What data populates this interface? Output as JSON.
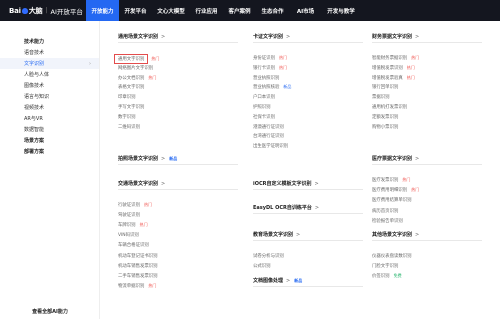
{
  "logo": {
    "mark_a": "Bai",
    "mark_b": "大脑",
    "separator": "|",
    "brand": "AI开放平台"
  },
  "nav": [
    "开放能力",
    "开发平台",
    "文心大模型",
    "行业应用",
    "客户案例",
    "生态合作",
    "AI市场",
    "开发与教学"
  ],
  "sidebar": {
    "items": [
      {
        "label": "技术能力",
        "kind": "group"
      },
      {
        "label": "语音技术",
        "kind": "item"
      },
      {
        "label": "文字识别",
        "kind": "active",
        "arrow": "›"
      },
      {
        "label": "人脸与人体",
        "kind": "item"
      },
      {
        "label": "图像技术",
        "kind": "item"
      },
      {
        "label": "语言与知识",
        "kind": "item"
      },
      {
        "label": "视频技术",
        "kind": "item"
      },
      {
        "label": "AR与VR",
        "kind": "item"
      },
      {
        "label": "数据智能",
        "kind": "item"
      },
      {
        "label": "场景方案",
        "kind": "group"
      },
      {
        "label": "部署方案",
        "kind": "group"
      }
    ],
    "footer": "查看全部AI能力"
  },
  "tags": {
    "hot": "热门",
    "new": "新品",
    "free": "免费"
  },
  "col1": {
    "s1": {
      "title": "通用场景文字识别",
      "chev": ">"
    },
    "s1_items": [
      {
        "label": "通用文字识别",
        "tag": "hot",
        "highlight": true
      },
      {
        "label": "网络图片文字识别",
        "tag": ""
      },
      {
        "label": "办公文档识别",
        "tag": "hot"
      },
      {
        "label": "表格文字识别",
        "tag": ""
      },
      {
        "label": "印章识别",
        "tag": ""
      },
      {
        "label": "手写文字识别",
        "tag": ""
      },
      {
        "label": "数字识别",
        "tag": ""
      },
      {
        "label": "二维码识别",
        "tag": ""
      }
    ],
    "s2": {
      "title": "拍照场景文字识别",
      "chev": ">",
      "tag": "new"
    },
    "s3": {
      "title": "交通场景文字识别",
      "chev": ">"
    },
    "s3_items": [
      {
        "label": "行驶证识别",
        "tag": "hot"
      },
      {
        "label": "驾驶证识别",
        "tag": ""
      },
      {
        "label": "车牌识别",
        "tag": "hot"
      },
      {
        "label": "VIN码识别",
        "tag": ""
      },
      {
        "label": "车辆合格证识别",
        "tag": ""
      },
      {
        "label": "机动车登记证书识别",
        "tag": ""
      },
      {
        "label": "机动车销售发票识别",
        "tag": ""
      },
      {
        "label": "二手车销售发票识别",
        "tag": ""
      },
      {
        "label": "物流单据识别",
        "tag": "hot"
      }
    ]
  },
  "col2": {
    "s1": {
      "title": "卡证文字识别",
      "chev": ">"
    },
    "s1_items": [
      {
        "label": "身份证识别",
        "tag": "hot"
      },
      {
        "label": "银行卡识别",
        "tag": "hot"
      },
      {
        "label": "营业执照识别",
        "tag": ""
      },
      {
        "label": "营业执照核验",
        "tag": "new"
      },
      {
        "label": "户口本识别",
        "tag": ""
      },
      {
        "label": "护照识别",
        "tag": ""
      },
      {
        "label": "社保卡识别",
        "tag": ""
      },
      {
        "label": "港澳通行证识别",
        "tag": ""
      },
      {
        "label": "台湾通行证识别",
        "tag": ""
      },
      {
        "label": "出生医学证明识别",
        "tag": ""
      }
    ],
    "s2": {
      "title": "iOCR自定义模板文字识别",
      "chev": ">"
    },
    "s3": {
      "title": "EasyDL OCR自训练平台",
      "chev": ">"
    },
    "s4": {
      "title": "教育场景文字识别",
      "chev": ">"
    },
    "s4_items": [
      {
        "label": "试卷分析与识别",
        "tag": ""
      },
      {
        "label": "公式识别",
        "tag": ""
      }
    ],
    "s5": {
      "title": "文档图像处理",
      "chev": ">",
      "tag": "new"
    }
  },
  "col3": {
    "s1": {
      "title": "财务票据文字识别",
      "chev": ">"
    },
    "s1_items": [
      {
        "label": "智能财务票据识别",
        "tag": "hot"
      },
      {
        "label": "增值税发票识别",
        "tag": "hot"
      },
      {
        "label": "增值税发票验真",
        "tag": "hot"
      },
      {
        "label": "银行回单识别",
        "tag": ""
      },
      {
        "label": "票据识别",
        "tag": ""
      },
      {
        "label": "通用机打发票识别",
        "tag": ""
      },
      {
        "label": "定额发票识别",
        "tag": ""
      },
      {
        "label": "购物小票识别",
        "tag": ""
      }
    ],
    "s2": {
      "title": "医疗票据文字识别",
      "chev": ">"
    },
    "s2_items": [
      {
        "label": "医疗发票识别",
        "tag": "hot"
      },
      {
        "label": "医疗费用明细识别",
        "tag": "hot"
      },
      {
        "label": "医疗费用结算单识别",
        "tag": ""
      },
      {
        "label": "病历首页识别",
        "tag": ""
      },
      {
        "label": "检验报告单识别",
        "tag": ""
      }
    ],
    "s3": {
      "title": "其他场景文字识别",
      "chev": ">"
    },
    "s3_items": [
      {
        "label": "仪器仪表盘读数识别",
        "tag": ""
      },
      {
        "label": "门脸文字识别",
        "tag": ""
      },
      {
        "label": "价签识别",
        "tag": "free"
      }
    ]
  }
}
